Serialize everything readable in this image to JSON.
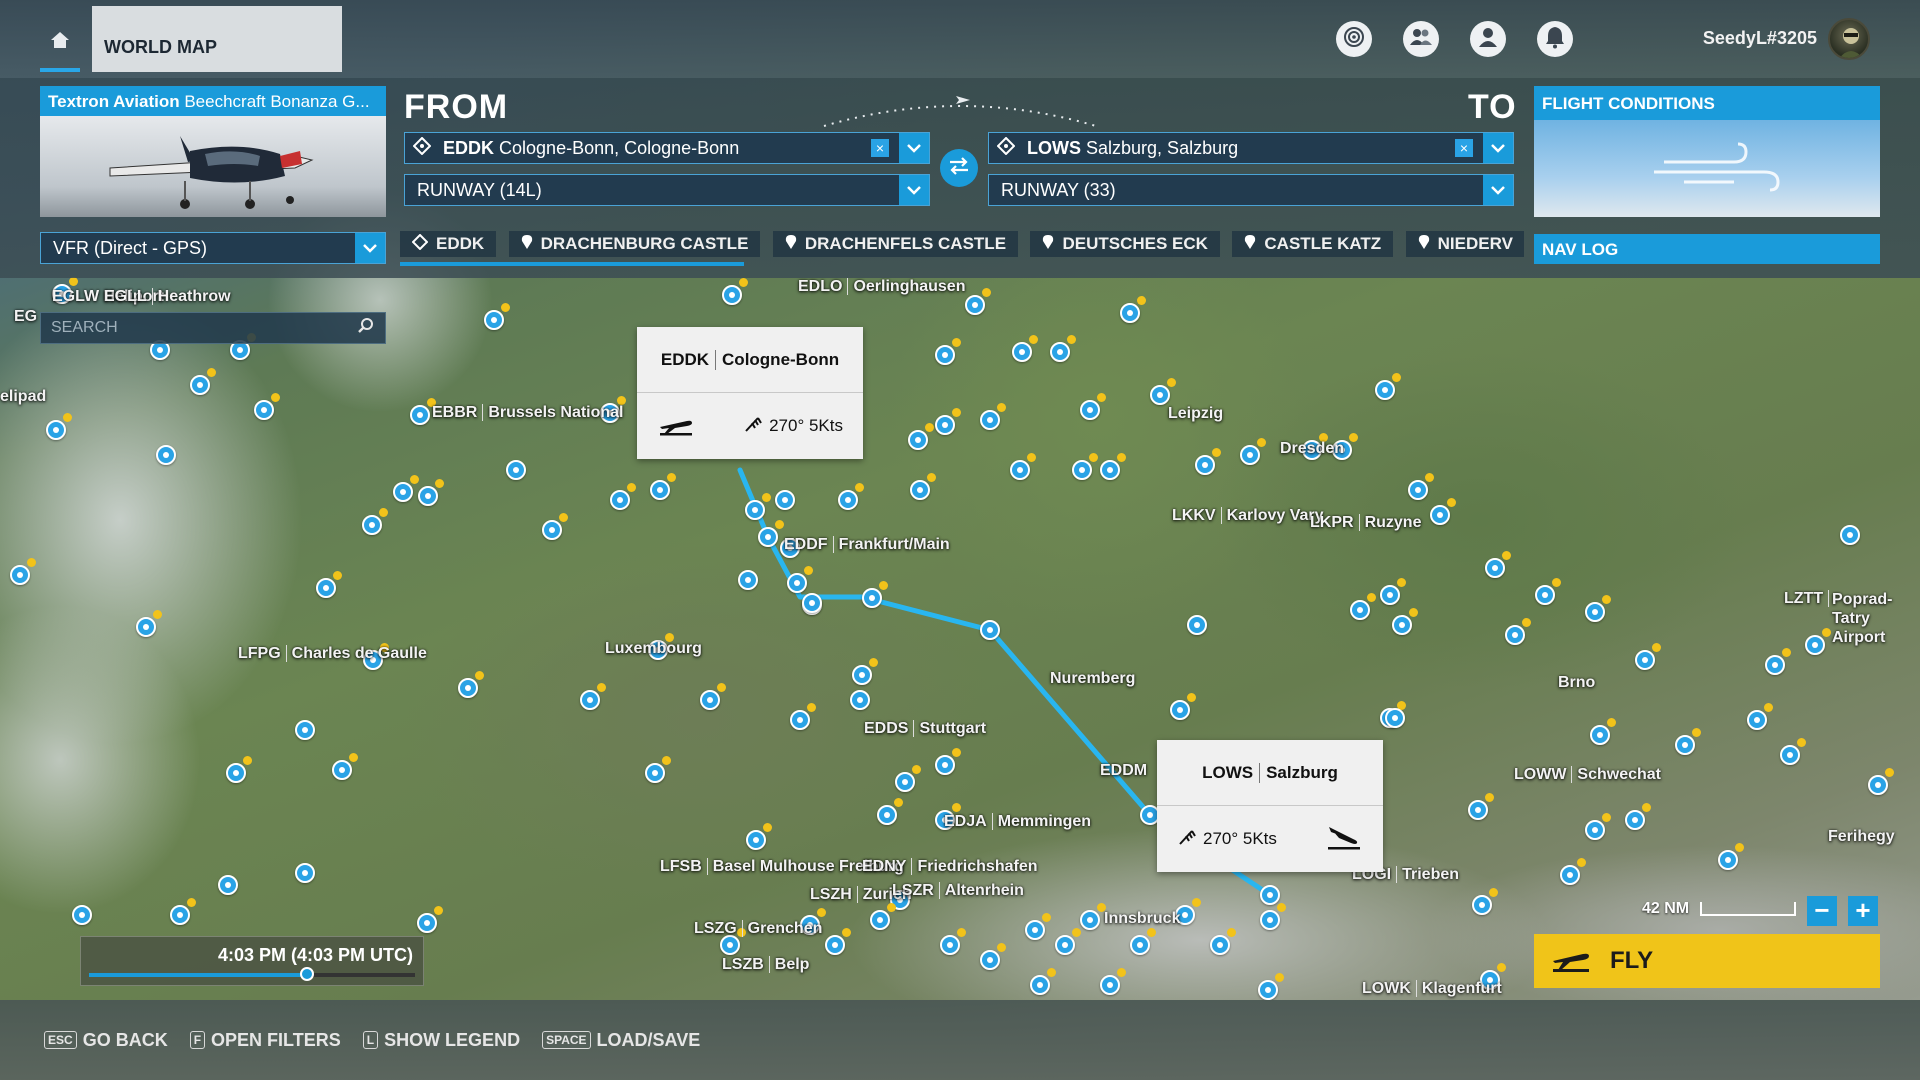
{
  "topbar": {
    "tab_label": "WORLD MAP",
    "username": "SeedyL#3205",
    "icons": [
      "home-icon",
      "activity-icon",
      "friends-icon",
      "profile-icon",
      "notification-bell-icon"
    ]
  },
  "aircraft": {
    "brand": "Textron Aviation",
    "model": "Beechcraft Bonanza G..."
  },
  "route": {
    "from_label": "FROM",
    "to_label": "TO",
    "departure": {
      "code": "EDDK",
      "name": "Cologne-Bonn, Cologne-Bonn",
      "clear": "×"
    },
    "departure_runway": "RUNWAY (14L)",
    "arrival": {
      "code": "LOWS",
      "name": "Salzburg, Salzburg",
      "clear": "×"
    },
    "arrival_runway": "RUNWAY (33)"
  },
  "flight_conditions": {
    "title": "FLIGHT CONDITIONS"
  },
  "flight_plan": {
    "selected": "VFR (Direct - GPS)"
  },
  "waypoints": [
    {
      "label": "EDDK",
      "icon": "airport-icon"
    },
    {
      "label": "DRACHENBURG CASTLE",
      "icon": "poi-pin-icon"
    },
    {
      "label": "DRACHENFELS CASTLE",
      "icon": "poi-pin-icon"
    },
    {
      "label": "DEUTSCHES ECK",
      "icon": "poi-pin-icon"
    },
    {
      "label": "CASTLE KATZ",
      "icon": "poi-pin-icon"
    },
    {
      "label": "NIEDERV",
      "icon": "poi-pin-icon"
    }
  ],
  "nav_log": {
    "label": "NAV LOG"
  },
  "search": {
    "placeholder": "SEARCH"
  },
  "departure_card": {
    "code": "EDDK",
    "name": "Cologne-Bonn",
    "wind": "270° 5Kts"
  },
  "arrival_card": {
    "code": "LOWS",
    "name": "Salzburg",
    "wind": "270° 5Kts"
  },
  "map_labels": {
    "eglw": "EGLW Heliport",
    "egll_code": "EGLL",
    "egll_name": "Heathrow",
    "eg": "EG",
    "eglc": "elipad",
    "ebbr_code": "EBBR",
    "ebbr_name": "Brussels National",
    "edlo_code": "EDLO",
    "edlo_name": "Oerlinghausen",
    "eddf_code": "EDDF",
    "eddf_name": "Frankfurt/Main",
    "lkkv_code": "LKKV",
    "lkkv_name": "Karlovy Vary",
    "lkpr_code": "LKPR",
    "lkpr_name": "Ruzyne",
    "lfpg_code": "LFPG",
    "lfpg_name": "Charles de Gaulle",
    "luxembourg": "Luxembourg",
    "nuremberg": "Nuremberg",
    "edds_code": "EDDS",
    "edds_name": "Stuttgart",
    "eddm": "EDDM",
    "edja_code": "EDJA",
    "edja_name": "Memmingen",
    "lfsb_code": "LFSB",
    "lfsb_name": "Basel Mulhouse Freiburg",
    "edny_code": "EDNY",
    "edny_name": "Friedrichshafen",
    "lszh_code": "LSZH",
    "lszh_name": "Zurich",
    "lszr_code": "LSZR",
    "lszr_name": "Altenrhein",
    "lszg_code": "LSZG",
    "lszg_name": "Grenchen",
    "lszb_code": "LSZB",
    "lszb_name": "Belp",
    "innsbruck": "Innsbruck",
    "logi_code": "LOGI",
    "logi_name": "Trieben",
    "lowk_code": "LOWK",
    "lowk_name": "Klagenfurt",
    "loww_code": "LOWW",
    "loww_name": "Schwechat",
    "brno": "Brno",
    "lztt_code": "LZTT",
    "lztt_name": "Poprad-Tatry Airport",
    "lhbp": "Ferihegy",
    "leipzig": "Leipzig",
    "dresden": "Dresden"
  },
  "time": {
    "label": "4:03 PM (4:03 PM UTC)",
    "progress": 0.67
  },
  "map_scale": {
    "label": "42 NM"
  },
  "zoom": {
    "minus": "−",
    "plus": "+"
  },
  "fly": {
    "label": "FLY"
  },
  "bottom_hints": [
    {
      "key": "ESC",
      "label": "GO BACK"
    },
    {
      "key": "F",
      "label": "OPEN FILTERS"
    },
    {
      "key": "L",
      "label": "SHOW LEGEND"
    },
    {
      "key": "SPACE",
      "label": "LOAD/SAVE"
    }
  ],
  "colors": {
    "accent": "#1a9bda",
    "fly": "#f0c419",
    "route": "#29b6f0"
  }
}
